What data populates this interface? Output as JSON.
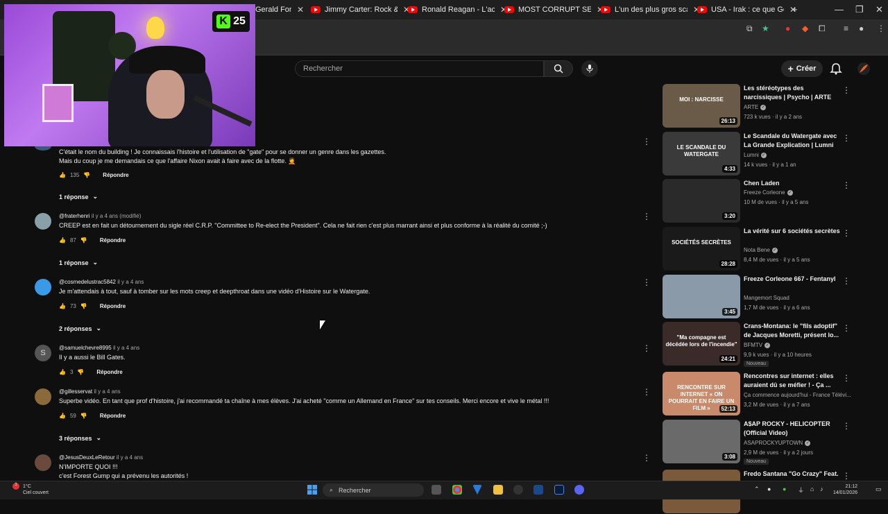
{
  "browser": {
    "tabs": [
      {
        "title": "Gerald Ford, u",
        "partial": true
      },
      {
        "title": "Jimmy Carter: Rock & Rol"
      },
      {
        "title": "Ronald Reagan - L'acteur"
      },
      {
        "title": "MOST CORRUPT SERIES:"
      },
      {
        "title": "L'un des plus gros scanda"
      },
      {
        "title": "USA - Irak : ce que Georg"
      }
    ],
    "new_tab": "+",
    "window_controls": [
      "—",
      "❐",
      "✕"
    ]
  },
  "stream_overlay": {
    "badge_letter": "K",
    "badge_count": "25"
  },
  "youtube": {
    "search_placeholder": "Rechercher",
    "create_label": "Créer"
  },
  "comments": [
    {
      "author": "",
      "time": "",
      "text_lines": [
        "C'était le nom du building ! Je connaissais l'histoire et l'utilisation de \"gate\" pour se donner un genre dans les gazettes.",
        "Mais du coup je me demandais ce que l'affaire Nixon avait à faire avec de la flotte. 🤦"
      ],
      "likes": "135",
      "reply_label": "Répondre",
      "replies": "1 réponse"
    },
    {
      "author": "@fraterhenri",
      "time": "il y a 4 ans (modifié)",
      "text_lines": [
        "CREEP est en fait un détournement du sigle réel C.R.P. \"Committee to Re-elect the President\". Cela ne fait rien c'est plus marrant ainsi et plus conforme à la réalité du comité ;-)"
      ],
      "likes": "87",
      "reply_label": "Répondre",
      "replies": "1 réponse"
    },
    {
      "author": "@cosmedelustrac5842",
      "time": "il y a 4 ans",
      "text_lines": [
        "Je m'attendais à tout, sauf à tomber sur les mots creep et deepthroat dans une vidéo d'Histoire sur le Watergate."
      ],
      "likes": "73",
      "reply_label": "Répondre",
      "replies": "2 réponses"
    },
    {
      "author": "@samuelchevre8995",
      "time": "il y a 4 ans",
      "avatar_letter": "S",
      "text_lines": [
        "Il y a aussi le Bill Gates."
      ],
      "likes": "3",
      "reply_label": "Répondre",
      "replies": ""
    },
    {
      "author": "@gillesservat",
      "time": "il y a 4 ans",
      "text_lines": [
        "Superbe vidéo. En tant que prof d'histoire, j'ai recommandé ta chaîne à mes élèves. J'ai acheté \"comme un Allemand en France\" sur tes conseils. Merci encore et vive le métal !!!"
      ],
      "likes": "59",
      "reply_label": "Répondre",
      "replies": "3 réponses"
    },
    {
      "author": "@JesusDeuxLeRetour",
      "time": "il y a 4 ans",
      "text_lines": [
        "N'IMPORTE QUOI !!!",
        "c'est Forest Gump qui a prévenu les autorités !"
      ],
      "likes": "",
      "reply_label": "",
      "replies": ""
    }
  ],
  "recommended": [
    {
      "title": "Les stéréotypes des narcissiques | Psycho | ARTE",
      "channel": "ARTE",
      "verified": true,
      "stats": "723 k vues · il y a 2 ans",
      "duration": "26:13",
      "thumb_text": "MOI : NARCISSE",
      "thumb_color": "#6a5a48"
    },
    {
      "title": "Le Scandale du Watergate avec La Grande Explication | Lumni",
      "channel": "Lumni",
      "verified": true,
      "stats": "14 k vues · il y a 1 an",
      "duration": "4:33",
      "thumb_text": "LE SCANDALE DU WATERGATE",
      "thumb_color": "#3a3a3a"
    },
    {
      "title": "Chen Laden",
      "channel": "Freeze Corleone",
      "verified": true,
      "stats": "10 M de vues · il y a 5 ans",
      "duration": "3:20",
      "thumb_text": "",
      "thumb_color": "#2a2a2a"
    },
    {
      "title": "La vérité sur 6 sociétés secrètes",
      "channel": "Nota Bene",
      "verified": true,
      "stats": "8,4 M de vues · il y a 5 ans",
      "duration": "28:28",
      "thumb_text": "SOCIÉTÉS SECRÈTES",
      "thumb_color": "#1a1a1a"
    },
    {
      "title": "Freeze Corleone 667 - Fentanyl",
      "channel": "Mangemort Squad",
      "verified": false,
      "stats": "1,7 M de vues · il y a 6 ans",
      "duration": "3:45",
      "thumb_text": "",
      "thumb_color": "#8a9aa8"
    },
    {
      "title": "Crans-Montana: le \"fils adoptif\" de Jacques Moretti, présent lo...",
      "channel": "BFMTV",
      "verified": true,
      "stats": "9,9 k vues · il y a 10 heures",
      "duration": "24:21",
      "thumb_text": "\"Ma compagne est décédée lors de l'incendie\"",
      "thumb_color": "#3a2a28",
      "badge": "Nouveau"
    },
    {
      "title": "Rencontres sur internet : elles auraient dû se méfier ! - Ça ...",
      "channel": "Ça commence aujourd'hui - France Télévi...",
      "verified": false,
      "stats": "3,2 M de vues · il y a 7 ans",
      "duration": "52:13",
      "thumb_text": "RENCONTRE SUR INTERNET « ON POURRAIT EN FAIRE UN FILM »",
      "thumb_color": "#c88a6a"
    },
    {
      "title": "A$AP ROCKY - HELICOPTER (Official Video)",
      "channel": "ASAPROCKYUPTOWN",
      "verified": true,
      "stats": "2,9 M de vues · il y a 2 jours",
      "duration": "3:08",
      "thumb_text": "",
      "thumb_color": "#6a6a6a",
      "badge": "Nouveau"
    },
    {
      "title": "Fredo Santana \"Go Crazy\" Feat.",
      "channel": "",
      "verified": false,
      "stats": "",
      "duration": "",
      "thumb_text": "",
      "thumb_color": "#7a5a3a"
    }
  ],
  "taskbar": {
    "weather_temp": "1°C",
    "weather_desc": "Ciel couvert",
    "search_label": "Rechercher",
    "time": "21:12",
    "date": "14/01/2026"
  }
}
